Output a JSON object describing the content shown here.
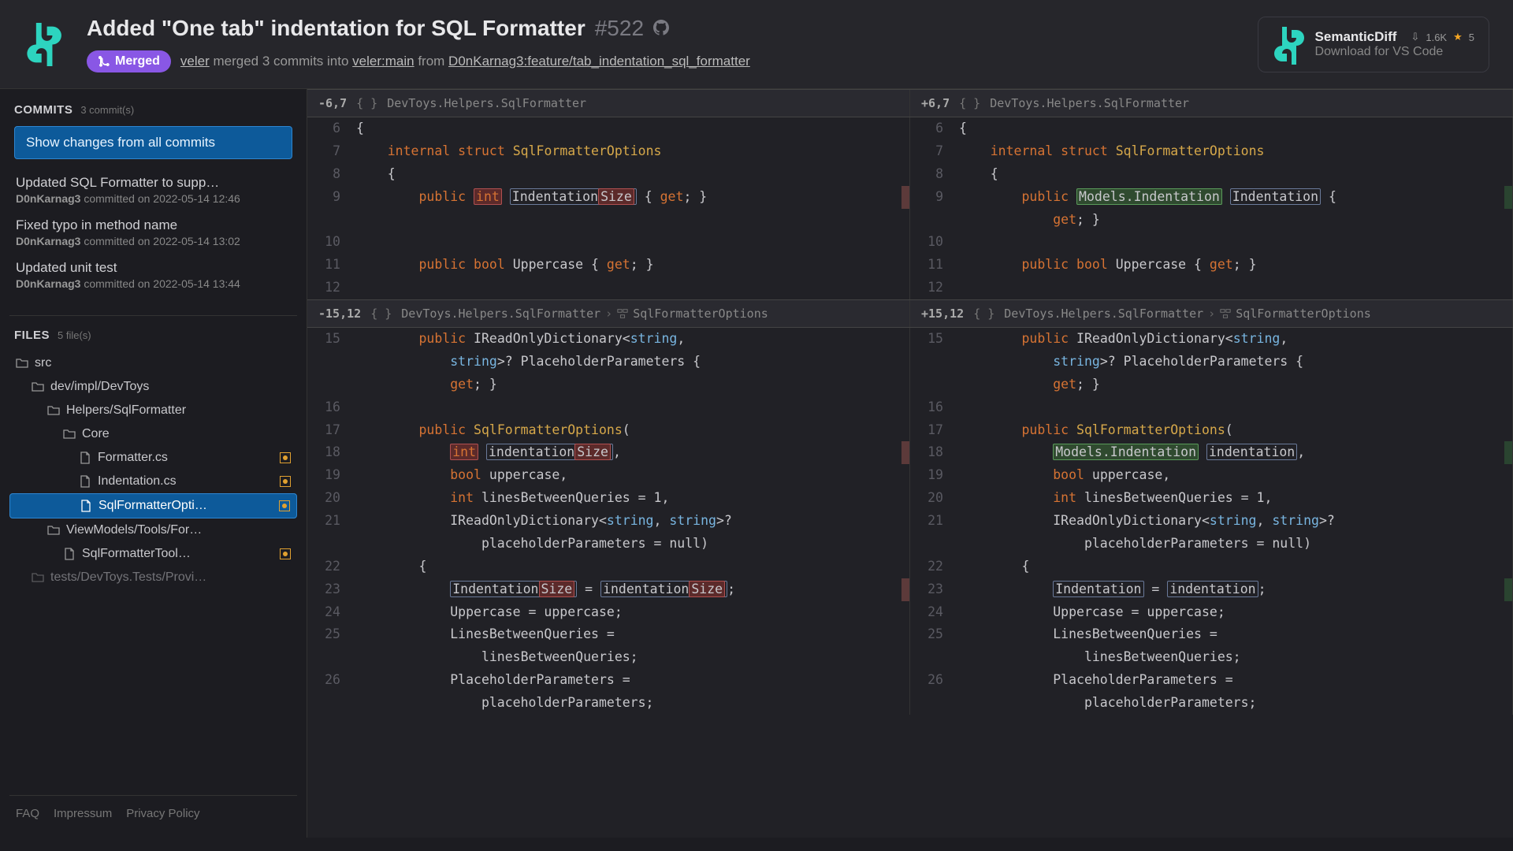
{
  "header": {
    "title": "Added \"One tab\" indentation for SQL Formatter",
    "pr_number": "#522",
    "merged_label": "Merged",
    "merge_text_1": "veler",
    "merge_text_2": " merged 3 commits into ",
    "merge_text_3": "veler:main",
    "merge_text_4": " from ",
    "merge_text_5": "D0nKarnag3:feature/tab_indentation_sql_formatter"
  },
  "promo": {
    "title": "SemanticDiff",
    "subtitle": "Download for VS Code",
    "downloads": "1.6K",
    "stars": "5"
  },
  "commits": {
    "section_title": "COMMITS",
    "count": "3 commit(s)",
    "button": "Show changes from all commits",
    "items": [
      {
        "title": "Updated SQL Formatter to supp…",
        "author": "D0nKarnag3",
        "meta": " committed on 2022-05-14 12:46"
      },
      {
        "title": "Fixed typo in method name",
        "author": "D0nKarnag3",
        "meta": " committed on 2022-05-14 13:02"
      },
      {
        "title": "Updated unit test",
        "author": "D0nKarnag3",
        "meta": " committed on 2022-05-14 13:44"
      }
    ]
  },
  "files": {
    "section_title": "FILES",
    "count": "5 file(s)",
    "tree": [
      {
        "label": "src",
        "type": "folder",
        "depth": 0
      },
      {
        "label": "dev/impl/DevToys",
        "type": "folder",
        "depth": 1
      },
      {
        "label": "Helpers/SqlFormatter",
        "type": "folder",
        "depth": 2
      },
      {
        "label": "Core",
        "type": "folder",
        "depth": 3
      },
      {
        "label": "Formatter.cs",
        "type": "file",
        "depth": 4,
        "changed": true
      },
      {
        "label": "Indentation.cs",
        "type": "file",
        "depth": 4,
        "changed": true
      },
      {
        "label": "SqlFormatterOpti…",
        "type": "file",
        "depth": 4,
        "changed": true,
        "selected": true
      },
      {
        "label": "ViewModels/Tools/For…",
        "type": "folder",
        "depth": 2
      },
      {
        "label": "SqlFormatterTool…",
        "type": "file",
        "depth": 3,
        "changed": true
      },
      {
        "label": "tests/DevToys.Tests/Provi…",
        "type": "folder",
        "depth": 1,
        "truncated": true
      }
    ]
  },
  "footer": {
    "faq": "FAQ",
    "impressum": "Impressum",
    "privacy": "Privacy Policy"
  },
  "hunks": [
    {
      "left_range": "-6,7",
      "right_range": "+6,7",
      "scope": "DevToys.Helpers.SqlFormatter",
      "sub_scope": null
    },
    {
      "left_range": "-15,12",
      "right_range": "+15,12",
      "scope": "DevToys.Helpers.SqlFormatter",
      "sub_scope": "SqlFormatterOptions"
    }
  ]
}
